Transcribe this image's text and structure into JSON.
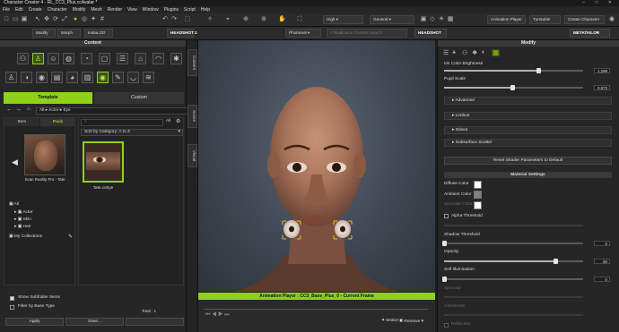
{
  "window": {
    "title": "Character Creator 4 - RL_CC3_Plus.ccAvatar *",
    "controls": "–  □  ✕"
  },
  "menu": [
    "File",
    "Edit",
    "Create",
    "Character",
    "Modify",
    "Mesh",
    "Render",
    "View",
    "Window",
    "Plugins",
    "Script",
    "Help"
  ],
  "toolbar1": {
    "quality": "High",
    "shading": "General",
    "animation_player": "Animation Player",
    "turntable": "Turntable",
    "create_character": "Create Character",
    "points": "Available Points"
  },
  "toolbar2": {
    "modify": "Modify",
    "morph": "Morph",
    "instalod": "InstaLOD",
    "headshot2": "HEADSHOT 2",
    "render_mode": "Photoreal",
    "search_placeholder": "Reallusion Content Search",
    "headshot": "HEADSHOT",
    "metatailor": "METATAILOR"
  },
  "content": {
    "header": "Content",
    "tabs": {
      "template": "Template",
      "custom": "Custom"
    },
    "breadcrumb": [
      "All",
      "Actor",
      "Eye"
    ],
    "sub_tabs": {
      "item": "Item",
      "pack": "Pack"
    },
    "pack_card": {
      "label": "Scan Reality Pro - Tate"
    },
    "item_card": {
      "label": "Tate.ccEye"
    },
    "search_all": "All",
    "sort": "Sort by Category: A to Z",
    "tree": [
      "All",
      "Actor",
      "Skin",
      "Hair",
      "My Collections"
    ],
    "show_subfolder": "Show Subfolder Items",
    "filter_base": "Filter by Base Type",
    "total": "Total : 1",
    "apply": "Apply",
    "save": "Save..."
  },
  "side_tabs": [
    "Content",
    "Scene",
    "Visual"
  ],
  "viewport": {
    "eye_handles": 2
  },
  "animation_player": {
    "title": "Animation Player : CC3_Base_Plus_0 - Current Frame",
    "motion": "Motion",
    "remove": "Remove"
  },
  "modify": {
    "header": "Modify",
    "iris_color_brightness": {
      "label": "Iris Color Brightness",
      "value": "1.299",
      "level": 0.68
    },
    "pupil_scale": {
      "label": "Pupil Scale",
      "value": "0.973",
      "level": 0.49
    },
    "sections": [
      "Advanced",
      "Limbus",
      "Sclera",
      "Subsurface Scatter"
    ],
    "reset": "Reset Shader Parameters to Default",
    "material_settings": "Material Settings",
    "diffuse_color": "Diffuse Color",
    "ambient_color": "Ambient Color",
    "specular_color": "Specular Color",
    "alpha_threshold": "Alpha Threshold",
    "shadow_threshold": {
      "label": "Shadow Threshold",
      "value": "0",
      "level": 0.0
    },
    "opacity": {
      "label": "Opacity",
      "value": "80",
      "level": 0.8
    },
    "self_illumination": {
      "label": "Self Illumination",
      "value": "0",
      "level": 0.0
    },
    "dim_labels": [
      "Specular",
      "Glossiness",
      "Reflection"
    ],
    "colors": {
      "accent": "#8fd11a",
      "diffuse": "#ffffff",
      "ambient": "#808080",
      "specular": "#ffffff"
    }
  }
}
